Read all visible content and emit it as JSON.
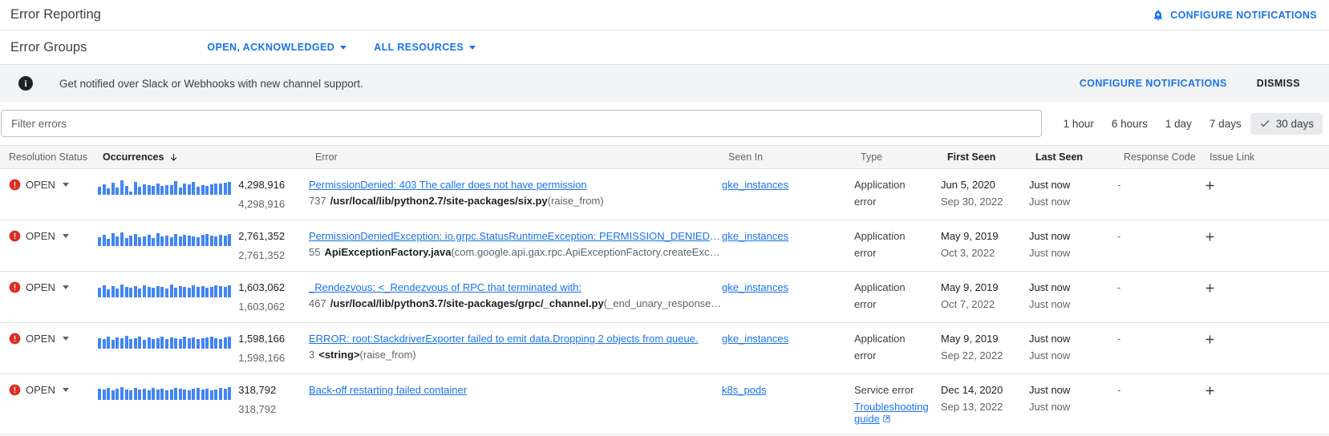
{
  "header": {
    "app_title": "Error Reporting",
    "configure_notifications": "CONFIGURE NOTIFICATIONS",
    "bell_icon": "bell-plus-icon"
  },
  "groupbar": {
    "title": "Error Groups",
    "status_filter": "OPEN, ACKNOWLEDGED",
    "resource_filter": "ALL RESOURCES"
  },
  "banner": {
    "icon": "info-icon",
    "text": "Get notified over Slack or Webhooks with new channel support.",
    "configure_label": "CONFIGURE NOTIFICATIONS",
    "dismiss_label": "DISMISS"
  },
  "filter": {
    "placeholder": "Filter errors",
    "value": ""
  },
  "time_ranges": [
    {
      "label": "1 hour",
      "selected": false
    },
    {
      "label": "6 hours",
      "selected": false
    },
    {
      "label": "1 day",
      "selected": false
    },
    {
      "label": "7 days",
      "selected": false
    },
    {
      "label": "30 days",
      "selected": true
    }
  ],
  "table": {
    "columns": [
      {
        "label": "Resolution Status",
        "strong": false
      },
      {
        "label": "Occurrences",
        "strong": true,
        "sort": "desc"
      },
      {
        "label": "Error",
        "strong": false
      },
      {
        "label": "Seen In",
        "strong": false
      },
      {
        "label": "Type",
        "strong": false
      },
      {
        "label": "First Seen",
        "strong": true
      },
      {
        "label": "Last Seen",
        "strong": true
      },
      {
        "label": "Response Code",
        "strong": false
      },
      {
        "label": "Issue Link",
        "strong": false
      }
    ],
    "rows": [
      {
        "status": "OPEN",
        "sparkline": [
          10,
          13,
          8,
          15,
          9,
          18,
          11,
          4,
          16,
          10,
          13,
          12,
          11,
          14,
          11,
          12,
          12,
          17,
          9,
          14,
          13,
          16,
          10,
          12,
          11,
          13,
          14,
          14,
          15,
          16
        ],
        "occurrences_top": "4,298,916",
        "occurrences_bottom": "4,298,916",
        "error_title": "PermissionDenied: 403 The caller does not have permission",
        "error_lineno": "737",
        "error_file": "/usr/local/lib/python2.7/site-packages/six.py",
        "error_func": "(raise_from)",
        "seen_in": "gke_instances",
        "type_main": "Application",
        "type_sub": "error",
        "type_sub_link": false,
        "first_seen_top": "Jun 5, 2020",
        "first_seen_bottom": "Sep 30, 2022",
        "last_seen_top": "Just now",
        "last_seen_bottom": "Just now",
        "response_code": "-",
        "issue_link": "plus-icon"
      },
      {
        "status": "OPEN",
        "sparkline": [
          11,
          14,
          9,
          16,
          12,
          17,
          10,
          13,
          15,
          11,
          12,
          14,
          10,
          16,
          12,
          13,
          11,
          15,
          12,
          14,
          13,
          12,
          11,
          14,
          15,
          13,
          12,
          14,
          13,
          15
        ],
        "occurrences_top": "2,761,352",
        "occurrences_bottom": "2,761,352",
        "error_title": "PermissionDeniedException: io.grpc.StatusRuntimeException: PERMISSION_DENIED: T…",
        "error_lineno": "55",
        "error_file": "ApiExceptionFactory.java",
        "error_func": "(com.google.api.gax.rpc.ApiExceptionFactory.createExcep…",
        "seen_in": "gke_instances",
        "type_main": "Application",
        "type_sub": "error",
        "type_sub_link": false,
        "first_seen_top": "May 9, 2019",
        "first_seen_bottom": "Oct 3, 2022",
        "last_seen_top": "Just now",
        "last_seen_bottom": "Just now",
        "response_code": "-",
        "issue_link": "plus-icon"
      },
      {
        "status": "OPEN",
        "sparkline": [
          12,
          15,
          10,
          14,
          11,
          16,
          13,
          12,
          14,
          11,
          15,
          13,
          12,
          14,
          13,
          11,
          16,
          12,
          14,
          13,
          12,
          15,
          13,
          14,
          12,
          13,
          15,
          14,
          13,
          15
        ],
        "occurrences_top": "1,603,062",
        "occurrences_bottom": "1,603,062",
        "error_title": "_Rendezvous: <_Rendezvous of RPC that terminated with:",
        "error_lineno": "467",
        "error_file": "/usr/local/lib/python3.7/site-packages/grpc/_channel.py",
        "error_func": "(_end_unary_response_bl…",
        "seen_in": "gke_instances",
        "type_main": "Application",
        "type_sub": "error",
        "type_sub_link": false,
        "first_seen_top": "May 9, 2019",
        "first_seen_bottom": "Oct 7, 2022",
        "last_seen_top": "Just now",
        "last_seen_bottom": "Just now",
        "response_code": "-",
        "issue_link": "plus-icon"
      },
      {
        "status": "OPEN",
        "sparkline": [
          13,
          12,
          15,
          11,
          14,
          13,
          16,
          12,
          13,
          15,
          11,
          14,
          12,
          13,
          15,
          12,
          14,
          13,
          12,
          15,
          13,
          14,
          12,
          13,
          14,
          15,
          13,
          12,
          14,
          15
        ],
        "occurrences_top": "1,598,166",
        "occurrences_bottom": "1,598,166",
        "error_title": "ERROR: root:StackdriverExporter failed to emit data.Dropping 2 objects from queue.",
        "error_lineno": "3",
        "error_file": "<string>",
        "error_func": "(raise_from)",
        "seen_in": "gke_instances",
        "type_main": "Application",
        "type_sub": "error",
        "type_sub_link": false,
        "first_seen_top": "May 9, 2019",
        "first_seen_bottom": "Sep 22, 2022",
        "last_seen_top": "Just now",
        "last_seen_bottom": "Just now",
        "response_code": "-",
        "issue_link": "plus-icon"
      },
      {
        "status": "OPEN",
        "sparkline": [
          14,
          13,
          15,
          12,
          14,
          16,
          13,
          12,
          15,
          13,
          14,
          12,
          15,
          13,
          14,
          12,
          13,
          15,
          14,
          13,
          12,
          14,
          15,
          13,
          14,
          12,
          13,
          15,
          14,
          16
        ],
        "occurrences_top": "318,792",
        "occurrences_bottom": "318,792",
        "error_title": "Back-off restarting failed container",
        "error_lineno": "",
        "error_file": "",
        "error_func": "",
        "seen_in": "k8s_pods",
        "type_main": "Service error",
        "type_sub": "Troubleshooting guide",
        "type_sub_link": true,
        "first_seen_top": "Dec 14, 2020",
        "first_seen_bottom": "Sep 13, 2022",
        "last_seen_top": "Just now",
        "last_seen_bottom": "Just now",
        "response_code": "-",
        "issue_link": "plus-icon"
      }
    ]
  },
  "colors": {
    "link": "#1a73e8",
    "spark_bar": "#4285f4",
    "error_red": "#d93025",
    "banner_bg": "#f1f3f4",
    "header_bg": "#f5f5f5"
  }
}
